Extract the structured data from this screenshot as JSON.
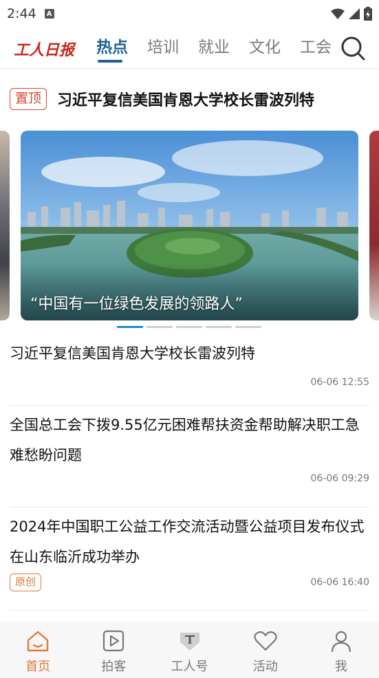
{
  "status_bar": {
    "time": "2:44",
    "notification_letter": "A"
  },
  "header": {
    "logo_text": "工人日报",
    "tabs": [
      {
        "label": "热点",
        "active": true
      },
      {
        "label": "培训",
        "active": false
      },
      {
        "label": "就业",
        "active": false
      },
      {
        "label": "文化",
        "active": false
      },
      {
        "label": "工会",
        "active": false
      }
    ],
    "search_icon": "search-icon"
  },
  "pinned": {
    "badge": "置顶",
    "title": "习近平复信美国肯恩大学校长雷波列特"
  },
  "carousel": {
    "caption": "“中国有一位绿色发展的领路人”",
    "slide_count": 5,
    "active_index": 0
  },
  "news": [
    {
      "title": "习近平复信美国肯恩大学校长雷波列特",
      "time": "06-06 12:55",
      "badge": ""
    },
    {
      "title": "全国总工会下拨9.55亿元困难帮扶资金帮助解决职工急难愁盼问题",
      "time": "06-06 09:29",
      "badge": ""
    },
    {
      "title": "2024年中国职工公益工作交流活动暨公益项目发布仪式在山东临沂成功举办",
      "time": "06-06 16:40",
      "badge": "原创"
    }
  ],
  "bottom_nav": [
    {
      "label": "首页",
      "icon": "home-icon",
      "active": true
    },
    {
      "label": "拍客",
      "icon": "video-play-icon",
      "active": false
    },
    {
      "label": "工人号",
      "icon": "worker-account-icon",
      "active": false
    },
    {
      "label": "活动",
      "icon": "heart-icon",
      "active": false
    },
    {
      "label": "我",
      "icon": "person-icon",
      "active": false
    }
  ],
  "colors": {
    "accent": "#1c5f9c",
    "brand_red": "#c8281e",
    "active_nav": "#e07a38",
    "pin_red": "#d9452f"
  }
}
